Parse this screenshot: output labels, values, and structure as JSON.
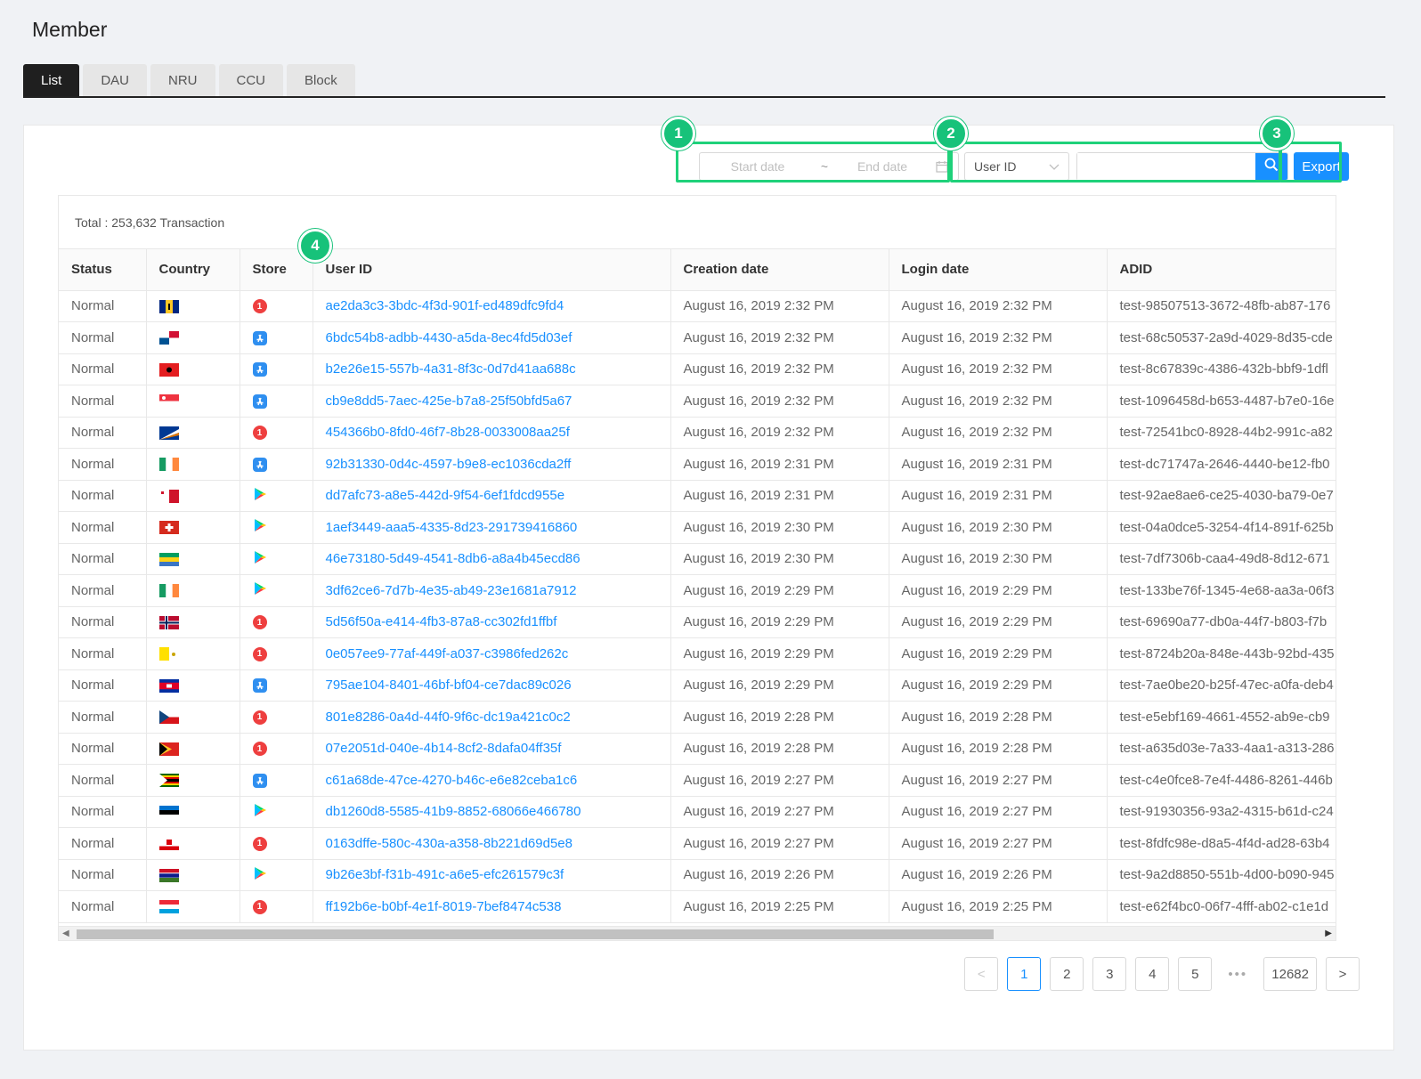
{
  "page": {
    "title": "Member"
  },
  "tabs": [
    {
      "label": "List",
      "active": true
    },
    {
      "label": "DAU",
      "active": false
    },
    {
      "label": "NRU",
      "active": false
    },
    {
      "label": "CCU",
      "active": false
    },
    {
      "label": "Block",
      "active": false
    }
  ],
  "filters": {
    "start_placeholder": "Start date",
    "range_separator": "~",
    "end_placeholder": "End date",
    "search_type": "User ID",
    "search_value": "",
    "export_label": "Export"
  },
  "annotations": [
    "1",
    "2",
    "3",
    "4"
  ],
  "colors": {
    "accent": "#1890ff",
    "highlight": "#1fd17a",
    "active_tab": "#1f1f1f"
  },
  "table": {
    "total": "Total : 253,632 Transaction",
    "columns": [
      "Status",
      "Country",
      "Store",
      "User ID",
      "Creation date",
      "Login date",
      "ADID"
    ],
    "rows": [
      {
        "status": "Normal",
        "flag": "barbados-flag",
        "store": "onestore",
        "user_id": "ae2da3c3-3bdc-4f3d-901f-ed489dfc9fd4",
        "created": "August 16, 2019 2:32 PM",
        "login": "August 16, 2019 2:32 PM",
        "adid": "test-98507513-3672-48fb-ab87-176"
      },
      {
        "status": "Normal",
        "flag": "panama-flag",
        "store": "apple",
        "user_id": "6bdc54b8-adbb-4430-a5da-8ec4fd5d03ef",
        "created": "August 16, 2019 2:32 PM",
        "login": "August 16, 2019 2:32 PM",
        "adid": "test-68c50537-2a9d-4029-8d35-cde"
      },
      {
        "status": "Normal",
        "flag": "albania-flag",
        "store": "apple",
        "user_id": "b2e26e15-557b-4a31-8f3c-0d7d41aa688c",
        "created": "August 16, 2019 2:32 PM",
        "login": "August 16, 2019 2:32 PM",
        "adid": "test-8c67839c-4386-432b-bbf9-1dfl"
      },
      {
        "status": "Normal",
        "flag": "singapore-flag",
        "store": "apple",
        "user_id": "cb9e8dd5-7aec-425e-b7a8-25f50bfd5a67",
        "created": "August 16, 2019 2:32 PM",
        "login": "August 16, 2019 2:32 PM",
        "adid": "test-1096458d-b653-4487-b7e0-16e"
      },
      {
        "status": "Normal",
        "flag": "marshall-islands-flag",
        "store": "onestore",
        "user_id": "454366b0-8fd0-46f7-8b28-0033008aa25f",
        "created": "August 16, 2019 2:32 PM",
        "login": "August 16, 2019 2:32 PM",
        "adid": "test-72541bc0-8928-44b2-991c-a82"
      },
      {
        "status": "Normal",
        "flag": "ireland-flag",
        "store": "apple",
        "user_id": "92b31330-0d4c-4597-b9e8-ec1036cda2ff",
        "created": "August 16, 2019 2:31 PM",
        "login": "August 16, 2019 2:31 PM",
        "adid": "test-dc71747a-2646-4440-be12-fb0"
      },
      {
        "status": "Normal",
        "flag": "malta-flag",
        "store": "googleplay",
        "user_id": "dd7afc73-a8e5-442d-9f54-6ef1fdcd955e",
        "created": "August 16, 2019 2:31 PM",
        "login": "August 16, 2019 2:31 PM",
        "adid": "test-92ae8ae6-ce25-4030-ba79-0e7"
      },
      {
        "status": "Normal",
        "flag": "switzerland-flag",
        "store": "googleplay",
        "user_id": "1aef3449-aaa5-4335-8d23-291739416860",
        "created": "August 16, 2019 2:30 PM",
        "login": "August 16, 2019 2:30 PM",
        "adid": "test-04a0dce5-3254-4f14-891f-625b"
      },
      {
        "status": "Normal",
        "flag": "gabon-flag",
        "store": "googleplay",
        "user_id": "46e73180-5d49-4541-8db6-a8a4b45ecd86",
        "created": "August 16, 2019 2:30 PM",
        "login": "August 16, 2019 2:30 PM",
        "adid": "test-7df7306b-caa4-49d8-8d12-671"
      },
      {
        "status": "Normal",
        "flag": "ireland-flag",
        "store": "googleplay",
        "user_id": "3df62ce6-7d7b-4e35-ab49-23e1681a7912",
        "created": "August 16, 2019 2:29 PM",
        "login": "August 16, 2019 2:29 PM",
        "adid": "test-133be76f-1345-4e68-aa3a-06f3"
      },
      {
        "status": "Normal",
        "flag": "norway-flag",
        "store": "onestore",
        "user_id": "5d56f50a-e414-4fb3-87a8-cc302fd1ffbf",
        "created": "August 16, 2019 2:29 PM",
        "login": "August 16, 2019 2:29 PM",
        "adid": "test-69690a77-db0a-44f7-b803-f7b"
      },
      {
        "status": "Normal",
        "flag": "vatican-flag",
        "store": "onestore",
        "user_id": "0e057ee9-77af-449f-a037-c3986fed262c",
        "created": "August 16, 2019 2:29 PM",
        "login": "August 16, 2019 2:29 PM",
        "adid": "test-8724b20a-848e-443b-92bd-435"
      },
      {
        "status": "Normal",
        "flag": "cambodia-flag",
        "store": "apple",
        "user_id": "795ae104-8401-46bf-bf04-ce7dac89c026",
        "created": "August 16, 2019 2:29 PM",
        "login": "August 16, 2019 2:29 PM",
        "adid": "test-7ae0be20-b25f-47ec-a0fa-deb4"
      },
      {
        "status": "Normal",
        "flag": "czech-flag",
        "store": "onestore",
        "user_id": "801e8286-0a4d-44f0-9f6c-dc19a421c0c2",
        "created": "August 16, 2019 2:28 PM",
        "login": "August 16, 2019 2:28 PM",
        "adid": "test-e5ebf169-4661-4552-ab9e-cb9"
      },
      {
        "status": "Normal",
        "flag": "timor-leste-flag",
        "store": "onestore",
        "user_id": "07e2051d-040e-4b14-8cf2-8dafa04ff35f",
        "created": "August 16, 2019 2:28 PM",
        "login": "August 16, 2019 2:28 PM",
        "adid": "test-a635d03e-7a33-4aa1-a313-286"
      },
      {
        "status": "Normal",
        "flag": "zimbabwe-flag",
        "store": "apple",
        "user_id": "c61a68de-47ce-4270-b46c-e6e82ceba1c6",
        "created": "August 16, 2019 2:27 PM",
        "login": "August 16, 2019 2:27 PM",
        "adid": "test-c4e0fce8-7e4f-4486-8261-446b"
      },
      {
        "status": "Normal",
        "flag": "estonia-flag",
        "store": "googleplay",
        "user_id": "db1260d8-5585-41b9-8852-68066e466780",
        "created": "August 16, 2019 2:27 PM",
        "login": "August 16, 2019 2:27 PM",
        "adid": "test-91930356-93a2-4315-b61d-c24"
      },
      {
        "status": "Normal",
        "flag": "gibraltar-flag",
        "store": "onestore",
        "user_id": "0163dffe-580c-430a-a358-8b221d69d5e8",
        "created": "August 16, 2019 2:27 PM",
        "login": "August 16, 2019 2:27 PM",
        "adid": "test-8fdfc98e-d8a5-4f4d-ad28-63b4"
      },
      {
        "status": "Normal",
        "flag": "gambia-flag",
        "store": "googleplay",
        "user_id": "9b26e3bf-f31b-491c-a6e5-efc261579c3f",
        "created": "August 16, 2019 2:26 PM",
        "login": "August 16, 2019 2:26 PM",
        "adid": "test-9a2d8850-551b-4d00-b090-945"
      },
      {
        "status": "Normal",
        "flag": "luxembourg-flag",
        "store": "onestore",
        "user_id": "ff192b6e-b0bf-4e1f-8019-7bef8474c538",
        "created": "August 16, 2019 2:25 PM",
        "login": "August 16, 2019 2:25 PM",
        "adid": "test-e62f4bc0-06f7-4fff-ab02-c1e1d"
      }
    ]
  },
  "pagination": {
    "prev": "<",
    "pages": [
      "1",
      "2",
      "3",
      "4",
      "5"
    ],
    "current": "1",
    "ellipsis": "•••",
    "last": "12682",
    "next": ">"
  }
}
